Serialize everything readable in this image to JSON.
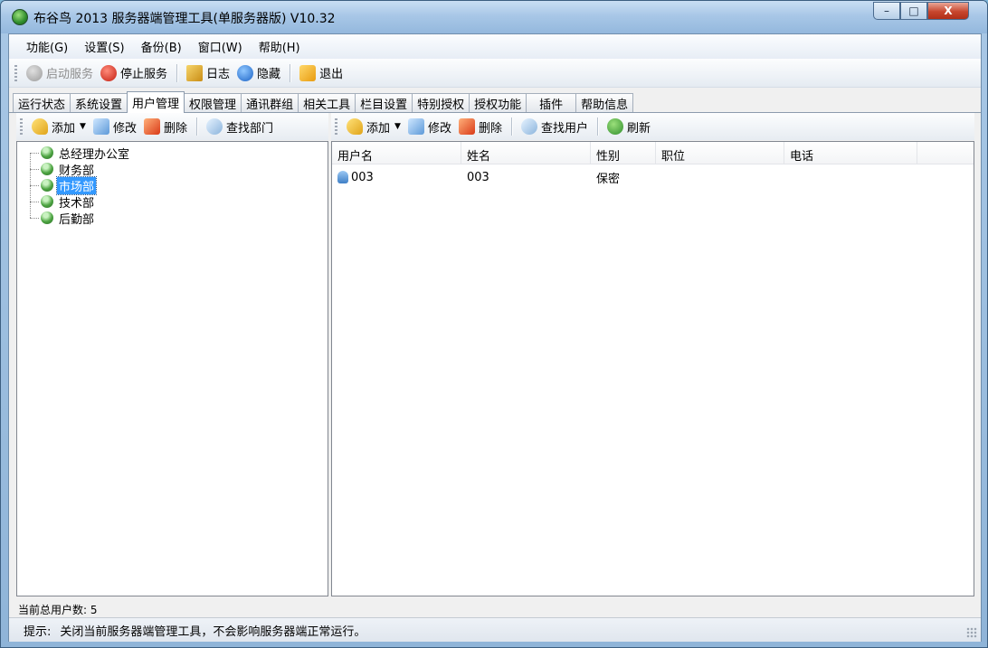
{
  "window": {
    "title": "布谷鸟 2013 服务器端管理工具(单服务器版) V10.32",
    "controls": {
      "minimize": "–",
      "maximize": "□",
      "close": "X"
    }
  },
  "menu": [
    {
      "label": "功能(G)"
    },
    {
      "label": "设置(S)"
    },
    {
      "label": "备份(B)"
    },
    {
      "label": "窗口(W)"
    },
    {
      "label": "帮助(H)"
    }
  ],
  "toolbar": {
    "start": "启动服务",
    "stop": "停止服务",
    "log": "日志",
    "hide": "隐藏",
    "exit": "退出"
  },
  "tabs": [
    {
      "label": "运行状态"
    },
    {
      "label": "系统设置"
    },
    {
      "label": "用户管理",
      "active": true
    },
    {
      "label": "权限管理"
    },
    {
      "label": "通讯群组"
    },
    {
      "label": "相关工具"
    },
    {
      "label": "栏目设置"
    },
    {
      "label": "特别授权"
    },
    {
      "label": "授权功能"
    },
    {
      "label": "插件"
    },
    {
      "label": "帮助信息"
    }
  ],
  "dept_toolbar": {
    "add": "添加",
    "edit": "修改",
    "delete": "删除",
    "find": "查找部门"
  },
  "user_toolbar": {
    "add": "添加",
    "edit": "修改",
    "delete": "删除",
    "find": "查找用户",
    "refresh": "刷新"
  },
  "departments": [
    {
      "label": "总经理办公室"
    },
    {
      "label": "财务部"
    },
    {
      "label": "市场部",
      "selected": true
    },
    {
      "label": "技术部"
    },
    {
      "label": "后勤部"
    }
  ],
  "users_table": {
    "columns": [
      "用户名",
      "姓名",
      "性别",
      "职位",
      "电话"
    ],
    "rows": [
      {
        "username": "003",
        "name": "003",
        "gender": "保密",
        "position": "",
        "phone": ""
      }
    ]
  },
  "status": {
    "total_users": "当前总用户数: 5",
    "hint_label": "提示:",
    "hint_text": "关闭当前服务器端管理工具，不会影响服务器端正常运行。"
  }
}
